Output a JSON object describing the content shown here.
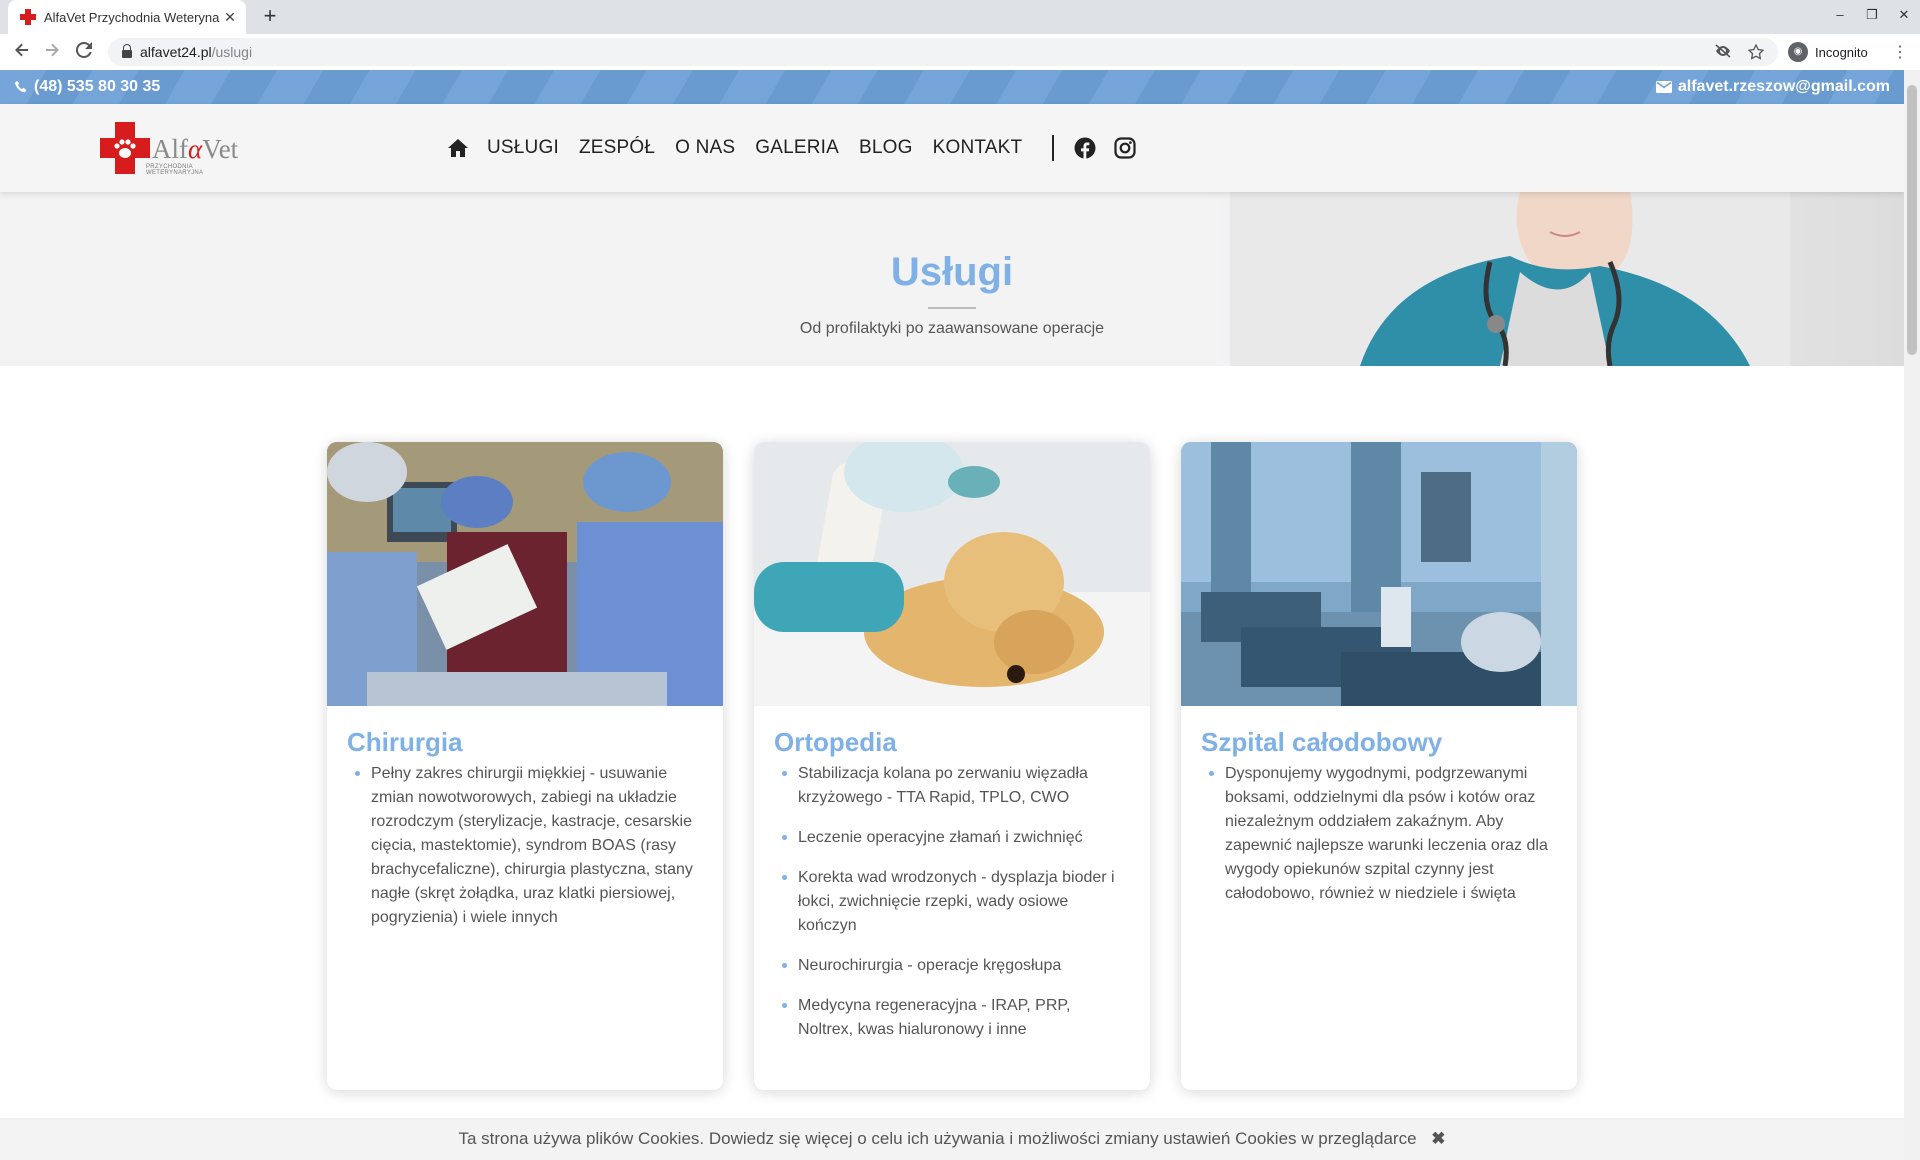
{
  "browser": {
    "tab_title": "AlfaVet Przychodnia Weterynaryjna",
    "tab_close": "✕",
    "new_tab": "+",
    "url_host": "alfavet24.pl",
    "url_path": "/uslugi",
    "incognito_label": "Incognito",
    "window_controls": [
      "–",
      "❐",
      "✕"
    ]
  },
  "topbar": {
    "phone": "(48) 535 80 30 35",
    "email": "alfavet.rzeszow@gmail.com",
    "color": "#6c9fd7"
  },
  "logo": {
    "word_part1": "Alf",
    "word_part2": "α",
    "word_part3": "Vet",
    "tagline": "PRZYCHODNIA WETERYNARYJNA"
  },
  "nav": {
    "items": [
      "USŁUGI",
      "ZESPÓŁ",
      "O NAS",
      "GALERIA",
      "BLOG",
      "KONTAKT"
    ]
  },
  "hero": {
    "title": "Usługi",
    "subtitle": "Od profilaktyki po zaawansowane operacje"
  },
  "cards": [
    {
      "title": "Chirurgia",
      "items": [
        "Pełny zakres chirurgii miękkiej - usuwanie zmian nowotworowych, zabiegi na układzie rozrodczym (sterylizacje, kastracje, cesarskie cięcia, mastektomie), syndrom BOAS (rasy brachycefaliczne), chirurgia plastyczna, stany nagłe (skręt żołądka, uraz klatki piersiowej, pogryzienia) i wiele innych"
      ]
    },
    {
      "title": "Ortopedia",
      "items": [
        "Stabilizacja kolana po zerwaniu więzadła krzyżowego - TTA Rapid, TPLO, CWO",
        "Leczenie operacyjne złamań i zwichnięć",
        "Korekta wad wrodzonych - dysplazja bioder i łokci, zwichnięcie rzepki, wady osiowe kończyn",
        "Neurochirurgia - operacje kręgosłupa",
        "Medycyna regeneracyjna - IRAP, PRP, Noltrex, kwas hialuronowy i inne"
      ]
    },
    {
      "title": "Szpital całodobowy",
      "items": [
        "Dysponujemy wygodnymi, podgrzewanymi boksami, oddzielnymi dla psów i kotów oraz niezależnym oddziałem zakaźnym. Aby zapewnić najlepsze warunki leczenia oraz dla wygody opiekunów szpital czynny jest całodobowo, również w niedziele i święta"
      ]
    }
  ],
  "cookie": {
    "text": "Ta strona używa plików Cookies. Dowiedz się więcej o celu ich używania i możliwości zmiany ustawień Cookies w przeglądarce",
    "close": "✖"
  },
  "colors": {
    "accent": "#7fb0e6",
    "brand_red": "#d61c1c"
  }
}
